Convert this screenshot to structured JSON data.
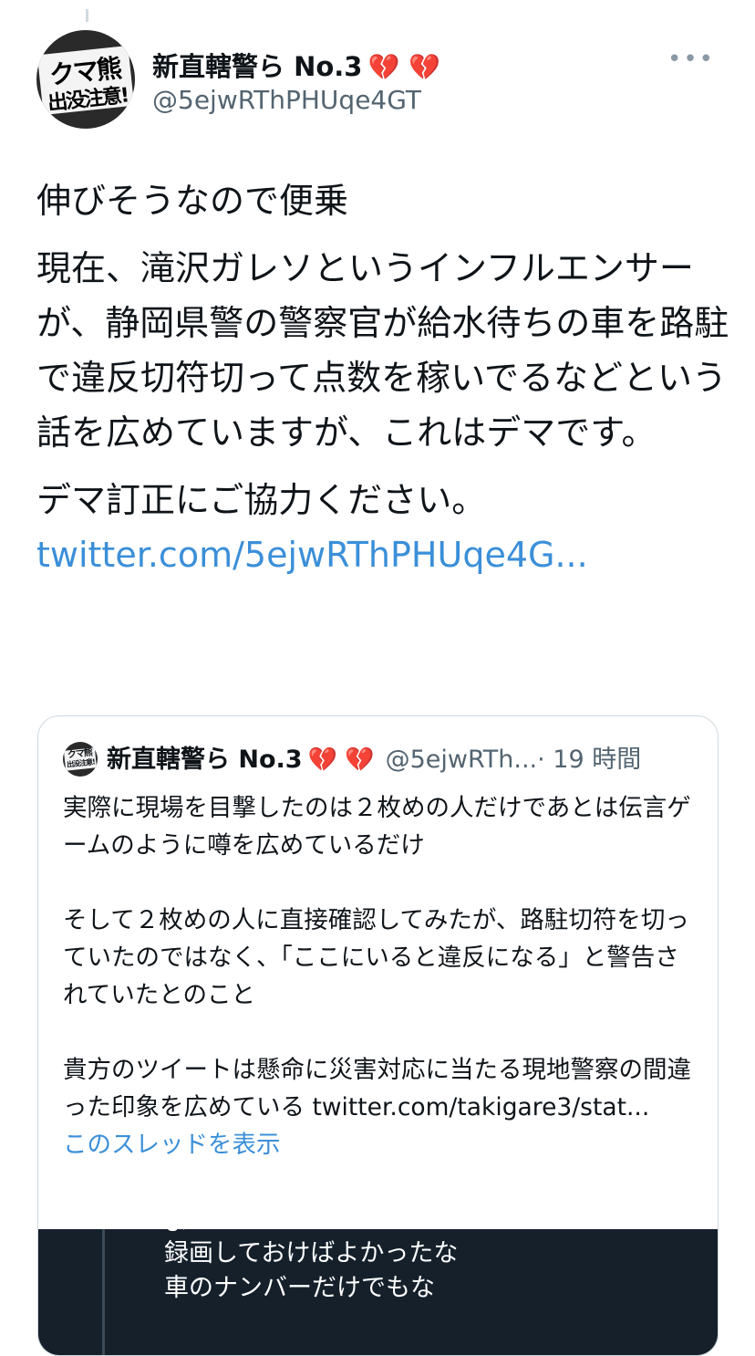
{
  "author": {
    "display_name": "新直轄警ら No.3",
    "hearts": "💔 💔",
    "handle": "@5ejwRThPHUqe4GT",
    "avatar_text_line1": "クマ熊",
    "avatar_text_line2": "出没注意!"
  },
  "tweet": {
    "paragraph1": "伸びそうなので便乗",
    "paragraph2": "現在、滝沢ガレソというインフルエンサーが、静岡県警の警察官が給水待ちの車を路駐で違反切符切って点数を稼いでるなどという話を広めていますが、これはデマです。",
    "paragraph3": "デマ訂正にご協力ください。",
    "link": "twitter.com/5ejwRThPHUqe4G..."
  },
  "quote": {
    "display_name": "新直轄警ら No.3",
    "hearts": "💔 💔",
    "handle": "@5ejwRTh...",
    "time": "· 19 時間",
    "paragraph1": "実際に現場を目撃したのは２枚めの人だけであとは伝言ゲームのように噂を広めているだけ",
    "paragraph2": "そして２枚めの人に直接確認してみたが、路駐切符を切っていたのではなく、「ここにいると違反になる」と警告されていたとのこと",
    "paragraph3_text": "貴方のツイートは懸命に災害対応に当たる現地警察の間違った印象を広めている ",
    "paragraph3_link": "twitter.com/takigare3/stat...",
    "show_thread": "このスレッドを表示",
    "image_line0": "よ",
    "image_line1": "録画しておけばよかったな",
    "image_line2": "車のナンバーだけでもな"
  }
}
